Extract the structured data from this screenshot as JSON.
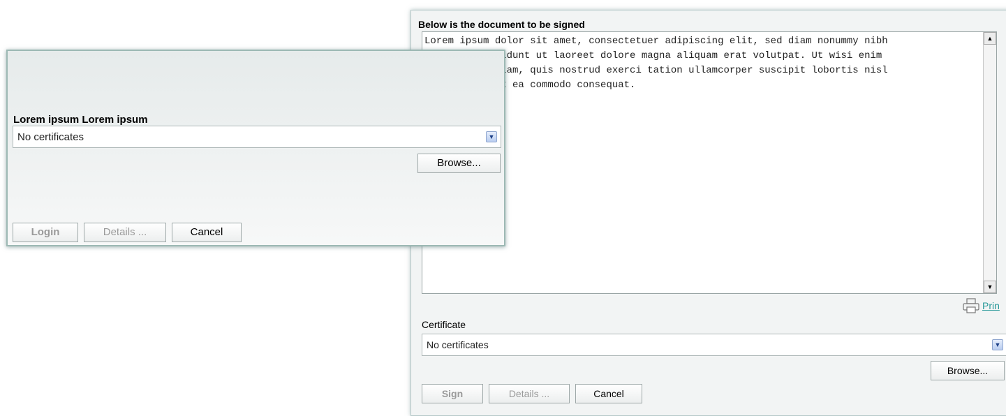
{
  "sign_dialog": {
    "title": "Below is the document to be signed",
    "document_text": "Lorem ipsum dolor sit amet, consectetuer adipiscing elit, sed diam nonummy nibh\n             idunt ut laoreet dolore magna aliquam erat volutpat. Ut wisi enim\n             iam, quis nostrud exerci tation ullamcorper suscipit lobortis nisl\n             x ea commodo consequat.",
    "print_label": "Prin",
    "certificate_label": "Certificate",
    "certificate_value": "No certificates",
    "browse_label": "Browse...",
    "sign_label": "Sign",
    "details_label": "Details ...",
    "cancel_label": "Cancel"
  },
  "login_dialog": {
    "title": "Lorem ipsum Lorem ipsum",
    "certificate_value": "No certificates",
    "browse_label": "Browse...",
    "login_label": "Login",
    "details_label": "Details ...",
    "cancel_label": "Cancel"
  },
  "colors": {
    "border_accent": "#9db9b4",
    "link": "#2a9a9a"
  }
}
